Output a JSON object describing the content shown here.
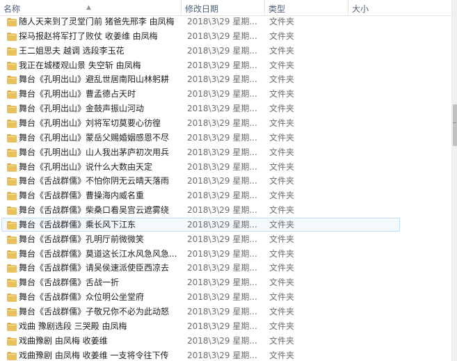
{
  "columns": {
    "name": "名称",
    "date": "修改日期",
    "type": "类型",
    "size": "大小"
  },
  "sort_indicator": "▲",
  "hover_index": 14,
  "rows": [
    {
      "name": "随人天来到了灵堂门前 猪爸先邢李 由凤梅",
      "date": "2018\\3\\29 星期...",
      "type": "文件夹"
    },
    {
      "name": "探马报赵将军打了败仗 收姜维 由凤梅",
      "date": "2018\\3\\29 星期...",
      "type": "文件夹"
    },
    {
      "name": "王二姐思夫 越调 选段李玉花",
      "date": "2018\\3\\29 星期...",
      "type": "文件夹"
    },
    {
      "name": "我正在城楼观山景 失空斩 由凤梅",
      "date": "2018\\3\\29 星期...",
      "type": "文件夹"
    },
    {
      "name": "舞台《孔明出山》避乱世居南阳山林躬耕",
      "date": "2018\\3\\29 星期...",
      "type": "文件夹"
    },
    {
      "name": "舞台《孔明出山》曹孟德占天时",
      "date": "2018\\3\\29 星期...",
      "type": "文件夹"
    },
    {
      "name": "舞台《孔明出山》金鼓声振山河动",
      "date": "2018\\3\\29 星期...",
      "type": "文件夹"
    },
    {
      "name": "舞台《孔明出山》刘将军切莫要心彷徨",
      "date": "2018\\3\\29 星期...",
      "type": "文件夹"
    },
    {
      "name": "舞台《孔明出山》蒙岳父赐婚姻感恩不尽",
      "date": "2018\\3\\29 星期...",
      "type": "文件夹"
    },
    {
      "name": "舞台《孔明出山》山人我出茅庐初次用兵",
      "date": "2018\\3\\29 星期...",
      "type": "文件夹"
    },
    {
      "name": "舞台《孔明出山》说什么大数由天定",
      "date": "2018\\3\\29 星期...",
      "type": "文件夹"
    },
    {
      "name": "舞台《舌战群儒》不怕你阴无云晴天落雨",
      "date": "2018\\3\\29 星期...",
      "type": "文件夹"
    },
    {
      "name": "舞台《舌战群儒》曹操海内威名重",
      "date": "2018\\3\\29 星期...",
      "type": "文件夹"
    },
    {
      "name": "舞台《舌战群儒》柴桑口看吴宫云遮雾绕",
      "date": "2018\\3\\29 星期...",
      "type": "文件夹"
    },
    {
      "name": "舞台《舌战群儒》乘长风下江东",
      "date": "2018\\3\\29 星期...",
      "type": "文件夹"
    },
    {
      "name": "舞台《舌战群儒》孔明厅前微微笑",
      "date": "2018\\3\\29 星期...",
      "type": "文件夹"
    },
    {
      "name": "舞台《舌战群儒》莫道这长江水风急风急...",
      "date": "2018\\3\\29 星期...",
      "type": "文件夹"
    },
    {
      "name": "舞台《舌战群儒》请吴侯速派使臣西凉去",
      "date": "2018\\3\\29 星期...",
      "type": "文件夹"
    },
    {
      "name": "舞台《舌战群儒》舌战一折",
      "date": "2018\\3\\29 星期...",
      "type": "文件夹"
    },
    {
      "name": "舞台《舌战群儒》众位明公坐堂府",
      "date": "2018\\3\\29 星期...",
      "type": "文件夹"
    },
    {
      "name": "舞台《舌战群儒》子敬兄你不必为此动怒",
      "date": "2018\\3\\29 星期...",
      "type": "文件夹"
    },
    {
      "name": "戏曲 豫剧选段 三哭殿 由凤梅",
      "date": "2018\\3\\29 星期...",
      "type": "文件夹"
    },
    {
      "name": "戏曲豫剧 由凤梅 收姜维",
      "date": "2018\\3\\29 星期...",
      "type": "文件夹"
    },
    {
      "name": "戏曲豫剧 由凤梅 收姜维 一支将令往下传",
      "date": "2018\\3\\29 星期...",
      "type": "文件夹"
    }
  ],
  "colors": {
    "folder_fill": "#e8c15a",
    "folder_dark": "#d4a53a",
    "hover_border": "#c3ddf6",
    "hover_bg": "#f4f9fe"
  }
}
